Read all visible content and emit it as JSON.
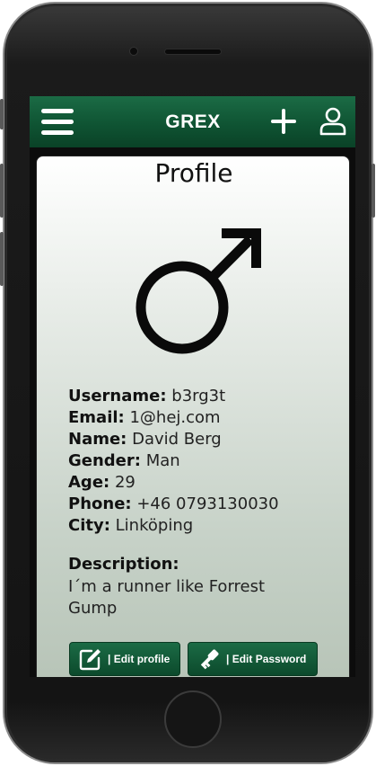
{
  "header": {
    "title": "GREX",
    "menu_icon": "hamburger-menu-icon",
    "add_icon": "plus-icon",
    "profile_icon": "user-icon",
    "color": "#0f5433"
  },
  "profile": {
    "page_title": "Profile",
    "gender_symbol": "male-symbol-icon",
    "fields": [
      {
        "label": "Username:",
        "value": "b3rg3t"
      },
      {
        "label": "Email:",
        "value": "1@hej.com"
      },
      {
        "label": "Name:",
        "value": "David Berg"
      },
      {
        "label": "Gender:",
        "value": "Man"
      },
      {
        "label": "Age:",
        "value": "29"
      },
      {
        "label": "Phone:",
        "value": "+46 0793130030"
      },
      {
        "label": "City:",
        "value": "Linköping"
      }
    ],
    "description_label": "Description:",
    "description_text": "I´m a runner like Forrest Gump"
  },
  "actions": {
    "edit_profile_label": "| Edit profile",
    "edit_profile_icon": "edit-icon",
    "edit_password_label": "| Edit Password",
    "edit_password_icon": "key-icon"
  }
}
